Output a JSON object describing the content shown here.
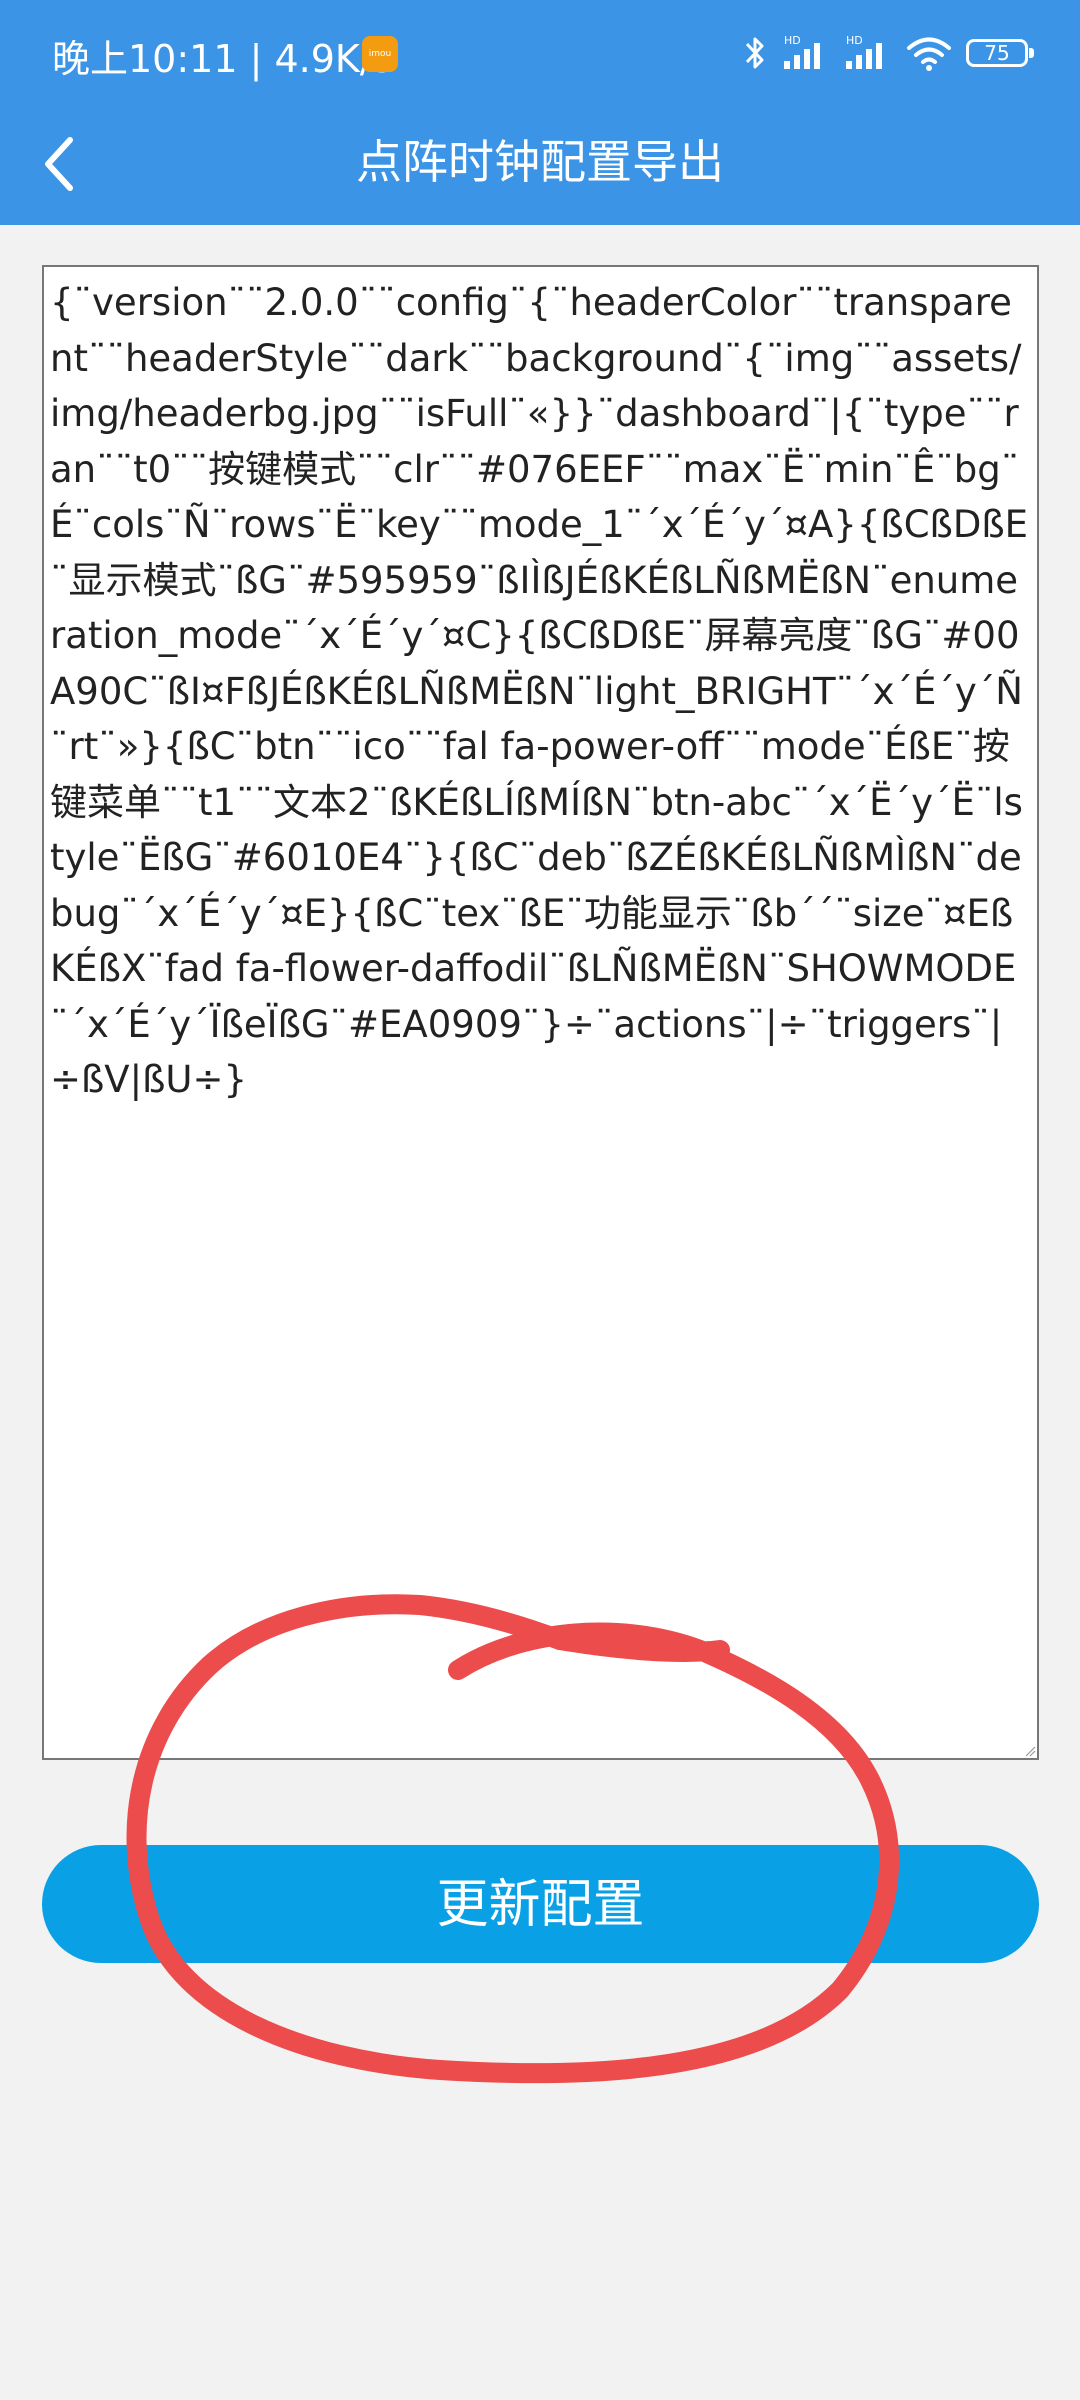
{
  "status_bar": {
    "time": "晚上10:11 | 4.9K/s",
    "app_icon": "imou-app-icon",
    "icons": [
      "bluetooth-icon",
      "signal-hd-icon",
      "signal-hd-icon",
      "wifi-icon"
    ],
    "battery": "75"
  },
  "app_bar": {
    "back_icon": "chevron-left-icon",
    "title": "点阵时钟配置导出"
  },
  "config": {
    "text": "{¨version¨¨2.0.0¨¨config¨{¨headerColor¨¨transparent¨¨headerStyle¨¨dark¨¨background¨{¨img¨¨assets/img/headerbg.jpg¨¨isFull¨«}}¨dashboard¨|{¨type¨¨ran¨¨t0¨¨按键模式¨¨clr¨¨#076EEF¨¨max¨Ë¨min¨Ê¨bg¨É¨cols¨Ñ¨rows¨Ë¨key¨¨mode_1¨´x´É´y´¤A}{ßCßDßE¨显示模式¨ßG¨#595959¨ßIÌßJÉßKÉßLÑßMËßN¨enumeration_mode¨´x´É´y´¤C}{ßCßDßE¨屏幕亮度¨ßG¨#00A90C¨ßI¤FßJÉßKÉßLÑßMËßN¨light_BRIGHT¨´x´É´y´Ñ¨rt¨»}{ßC¨btn¨¨ico¨¨fal fa-power-off¨¨mode¨ÉßE¨按键菜单¨¨t1¨¨文本2¨ßKÉßLÍßMÍßN¨btn-abc¨´x´Ë´y´Ë¨lstyle¨ËßG¨#6010E4¨}{ßC¨deb¨ßZÉßKÉßLÑßMÌßN¨debug¨´x´É´y´¤E}{ßC¨tex¨ßE¨功能显示¨ßb´´¨size¨¤EßKÉßX¨fad fa-flower-daffodil¨ßLÑßMËßN¨SHOWMODE¨´x´É´y´ÏßeÏßG¨#EA0909¨}÷¨actions¨|÷¨triggers¨|÷ßV|ßU÷}"
  },
  "update_button": {
    "label": "更新配置"
  },
  "annotation": {
    "color": "#ec4c4c"
  },
  "colors": {
    "header": "#3b94e6",
    "button": "#0aa0e6",
    "background": "#f2f2f2"
  }
}
